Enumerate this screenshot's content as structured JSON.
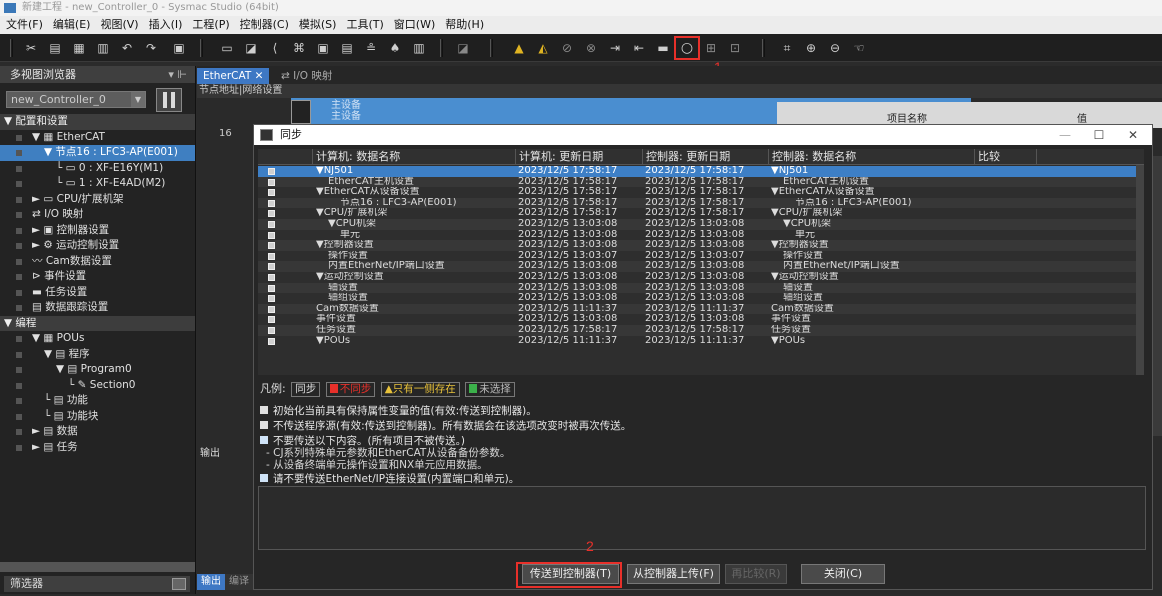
{
  "window": {
    "title": "新建工程 - new_Controller_0 - Sysmac Studio (64bit)"
  },
  "menu": [
    "文件(F)",
    "编辑(E)",
    "视图(V)",
    "插入(I)",
    "工程(P)",
    "控制器(C)",
    "模拟(S)",
    "工具(T)",
    "窗口(W)",
    "帮助(H)"
  ],
  "annotations": {
    "mark1": "1",
    "mark2": "2"
  },
  "left_pane": {
    "title": "多视图浏览器",
    "controller_select": "new_Controller_0",
    "tree": [
      {
        "label": "配置和设置",
        "level": 0,
        "kind": "hdr",
        "prefix": "▼"
      },
      {
        "label": "EtherCAT",
        "level": 1,
        "kind": "",
        "prefix": "▼ ▦"
      },
      {
        "label": "节点16 : LFC3-AP(E001)",
        "level": 2,
        "kind": "sel",
        "prefix": "▼"
      },
      {
        "label": "0 : XF-E16Y(M1)",
        "level": 3,
        "kind": "",
        "prefix": "└ ▭"
      },
      {
        "label": "1 : XF-E4AD(M2)",
        "level": 3,
        "kind": "",
        "prefix": "└ ▭"
      },
      {
        "label": "CPU/扩展机架",
        "level": 1,
        "kind": "",
        "prefix": "► ▭"
      },
      {
        "label": "I/O 映射",
        "level": 1,
        "kind": "",
        "prefix": "⇄"
      },
      {
        "label": "控制器设置",
        "level": 1,
        "kind": "",
        "prefix": "► ▣"
      },
      {
        "label": "运动控制设置",
        "level": 1,
        "kind": "",
        "prefix": "► ⚙"
      },
      {
        "label": "Cam数据设置",
        "level": 1,
        "kind": "",
        "prefix": "〰"
      },
      {
        "label": "事件设置",
        "level": 1,
        "kind": "",
        "prefix": "⊳"
      },
      {
        "label": "任务设置",
        "level": 1,
        "kind": "",
        "prefix": "▬"
      },
      {
        "label": "数据跟踪设置",
        "level": 1,
        "kind": "",
        "prefix": "▤"
      },
      {
        "label": "编程",
        "level": 0,
        "kind": "hdr",
        "prefix": "▼"
      },
      {
        "label": "POUs",
        "level": 1,
        "kind": "",
        "prefix": "▼ ▦"
      },
      {
        "label": "程序",
        "level": 2,
        "kind": "",
        "prefix": "▼ ▤"
      },
      {
        "label": "Program0",
        "level": 3,
        "kind": "",
        "prefix": "▼ ▤"
      },
      {
        "label": "Section0",
        "level": 4,
        "kind": "",
        "prefix": "└ ✎"
      },
      {
        "label": "功能",
        "level": 2,
        "kind": "",
        "prefix": "└ ▤"
      },
      {
        "label": "功能块",
        "level": 2,
        "kind": "",
        "prefix": "└ ▤"
      },
      {
        "label": "数据",
        "level": 1,
        "kind": "",
        "prefix": "► ▤"
      },
      {
        "label": "任务",
        "level": 1,
        "kind": "",
        "prefix": "► ▤"
      }
    ],
    "filter": "筛选器"
  },
  "center": {
    "tab_active": "EtherCAT",
    "tab_inactive": "I/O 映射",
    "net_header": "节点地址|网络设置",
    "master_line1": "主设备",
    "master_line2": "主设备",
    "node_addr": "16",
    "prop_header_name": "项目名称",
    "prop_header_value": "值",
    "output_label": "输出",
    "bottom_tab_output": "输出",
    "bottom_tab_compile": "编译"
  },
  "dialog": {
    "title": "同步",
    "columns": [
      "计算机: 数据名称",
      "计算机: 更新日期",
      "控制器: 更新日期",
      "控制器: 数据名称",
      "比较"
    ],
    "rows": [
      {
        "pc_name": "▼NJ501",
        "pc_date": "2023/12/5 17:58:17",
        "ctl_date": "2023/12/5 17:58:17",
        "ctl_name": "▼NJ501",
        "cmp": "",
        "indent": 0
      },
      {
        "pc_name": "EtherCAT主机设置",
        "pc_date": "2023/12/5 17:58:17",
        "ctl_date": "2023/12/5 17:58:17",
        "ctl_name": "EtherCAT主机设置",
        "cmp": "",
        "indent": 1
      },
      {
        "pc_name": "▼EtherCAT从设备设置",
        "pc_date": "2023/12/5 17:58:17",
        "ctl_date": "2023/12/5 17:58:17",
        "ctl_name": "▼EtherCAT从设备设置",
        "cmp": "",
        "indent": 0
      },
      {
        "pc_name": "节点16 : LFC3-AP(E001)",
        "pc_date": "2023/12/5 17:58:17",
        "ctl_date": "2023/12/5 17:58:17",
        "ctl_name": "节点16 : LFC3-AP(E001)",
        "cmp": "",
        "indent": 2
      },
      {
        "pc_name": "▼CPU/扩展机架",
        "pc_date": "2023/12/5 17:58:17",
        "ctl_date": "2023/12/5 17:58:17",
        "ctl_name": "▼CPU/扩展机架",
        "cmp": "",
        "indent": 0
      },
      {
        "pc_name": "▼CPU机架",
        "pc_date": "2023/12/5 13:03:08",
        "ctl_date": "2023/12/5 13:03:08",
        "ctl_name": "▼CPU机架",
        "cmp": "",
        "indent": 1
      },
      {
        "pc_name": "单元",
        "pc_date": "2023/12/5 13:03:08",
        "ctl_date": "2023/12/5 13:03:08",
        "ctl_name": "单元",
        "cmp": "",
        "indent": 2
      },
      {
        "pc_name": "▼控制器设置",
        "pc_date": "2023/12/5 13:03:08",
        "ctl_date": "2023/12/5 13:03:08",
        "ctl_name": "▼控制器设置",
        "cmp": "",
        "indent": 0
      },
      {
        "pc_name": "操作设置",
        "pc_date": "2023/12/5 13:03:07",
        "ctl_date": "2023/12/5 13:03:07",
        "ctl_name": "操作设置",
        "cmp": "",
        "indent": 1
      },
      {
        "pc_name": "内置EtherNet/IP端口设置",
        "pc_date": "2023/12/5 13:03:08",
        "ctl_date": "2023/12/5 13:03:08",
        "ctl_name": "内置EtherNet/IP端口设置",
        "cmp": "",
        "indent": 1
      },
      {
        "pc_name": "▼运动控制设置",
        "pc_date": "2023/12/5 13:03:08",
        "ctl_date": "2023/12/5 13:03:08",
        "ctl_name": "▼运动控制设置",
        "cmp": "",
        "indent": 0
      },
      {
        "pc_name": "轴设置",
        "pc_date": "2023/12/5 13:03:08",
        "ctl_date": "2023/12/5 13:03:08",
        "ctl_name": "轴设置",
        "cmp": "",
        "indent": 1
      },
      {
        "pc_name": "轴组设置",
        "pc_date": "2023/12/5 13:03:08",
        "ctl_date": "2023/12/5 13:03:08",
        "ctl_name": "轴组设置",
        "cmp": "",
        "indent": 1
      },
      {
        "pc_name": "Cam数据设置",
        "pc_date": "2023/12/5 11:11:37",
        "ctl_date": "2023/12/5 11:11:37",
        "ctl_name": "Cam数据设置",
        "cmp": "",
        "indent": 0
      },
      {
        "pc_name": "事件设置",
        "pc_date": "2023/12/5 13:03:08",
        "ctl_date": "2023/12/5 13:03:08",
        "ctl_name": "事件设置",
        "cmp": "",
        "indent": 0
      },
      {
        "pc_name": "任务设置",
        "pc_date": "2023/12/5 17:58:17",
        "ctl_date": "2023/12/5 17:58:17",
        "ctl_name": "任务设置",
        "cmp": "",
        "indent": 0
      },
      {
        "pc_name": "▼POUs",
        "pc_date": "2023/12/5 11:11:37",
        "ctl_date": "2023/12/5 11:11:37",
        "ctl_name": "▼POUs",
        "cmp": "",
        "indent": 0
      }
    ],
    "legend_label": "凡例:",
    "legend_sync": "同步",
    "legend_mismatch": "不同步",
    "legend_one_side": "只有一侧存在",
    "legend_unselected": "未选择",
    "option1": "初始化当前具有保持属性变量的值(有效:传送到控制器)。",
    "option2": "不传送程序源(有效:传送到控制器)。所有数据会在该选项改变时被再次传送。",
    "option3": "不要传送以下内容。(所有项目不被传送。)",
    "option3_sub1": "- CJ系列特殊单元参数和EtherCAT从设备备份参数。",
    "option3_sub2": "- 从设备终端单元操作设置和NX单元应用数据。",
    "option4": "请不要传送EtherNet/IP连接设置(内置端口和单元)。",
    "btn_transfer_to": "传送到控制器(T)",
    "btn_transfer_from": "从控制器上传(F)",
    "btn_recompare": "再比较(R)",
    "btn_close": "关闭(C)"
  }
}
